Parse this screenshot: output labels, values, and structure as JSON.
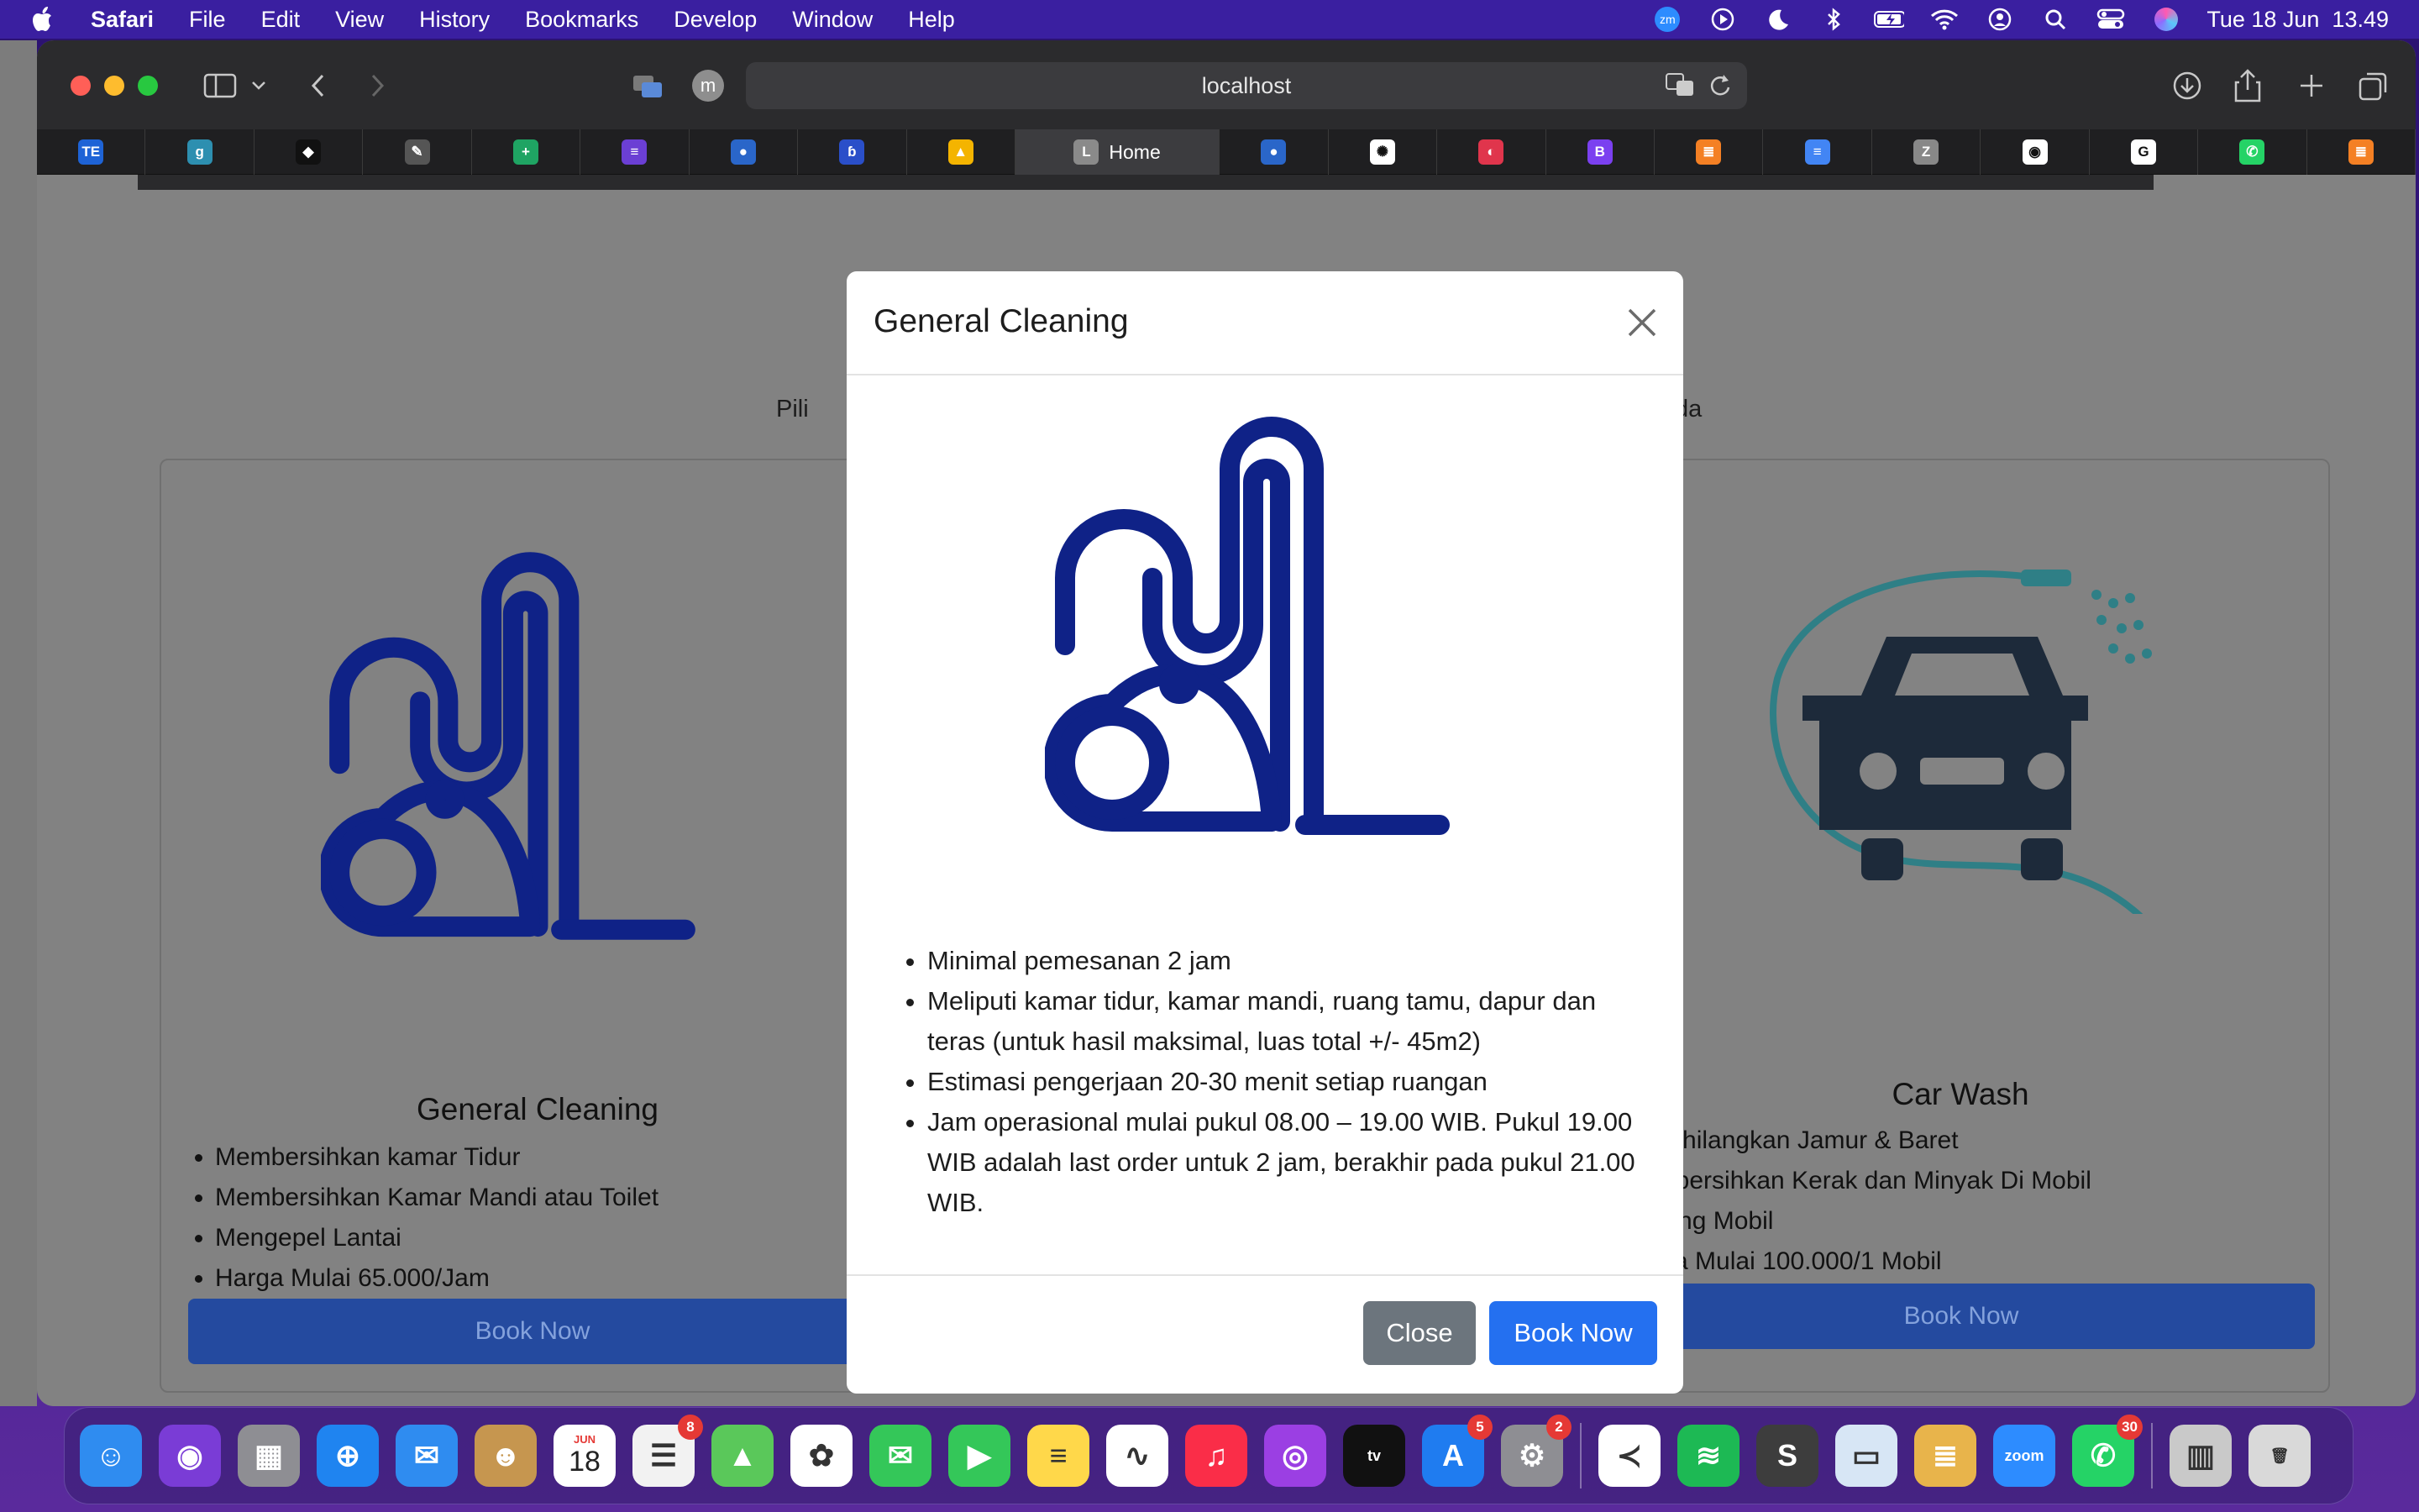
{
  "menubar": {
    "app": "Safari",
    "items": [
      "File",
      "Edit",
      "View",
      "History",
      "Bookmarks",
      "Develop",
      "Window",
      "Help"
    ],
    "status_icons": [
      "zoom-icon",
      "play-icon",
      "moon-icon",
      "bluetooth-icon",
      "battery-icon",
      "wifi-icon",
      "user-icon",
      "search-icon",
      "control-center-icon",
      "siri-icon"
    ],
    "zoom_label": "zm",
    "datetime": "Tue 18 Jun  13.49"
  },
  "browser": {
    "url": "localhost",
    "profile_initial": "m",
    "active_tab": {
      "label": "Home",
      "initial": "L"
    },
    "tabs": [
      {
        "icon": "tailwind-elements-icon",
        "color": "#1e63d6",
        "glyph": "TE"
      },
      {
        "icon": "grammar-icon",
        "color": "#2d8fb0",
        "glyph": "g"
      },
      {
        "icon": "codepen-icon",
        "color": "#111111",
        "glyph": "◆"
      },
      {
        "icon": "pencil-icon",
        "color": "#555555",
        "glyph": "✎"
      },
      {
        "icon": "sheets-icon",
        "color": "#1fa463",
        "glyph": "+"
      },
      {
        "icon": "forms-icon",
        "color": "#6b3fd4",
        "glyph": "≡"
      },
      {
        "icon": "tutwuri-icon",
        "color": "#2a66c9",
        "glyph": "●"
      },
      {
        "icon": "drop-icon",
        "color": "#2a4fc9",
        "glyph": "ɓ"
      },
      {
        "icon": "drive-icon",
        "color": "#f4b400",
        "glyph": "▲"
      },
      {
        "icon": "tutwuri-icon",
        "color": "#2a66c9",
        "glyph": "●"
      },
      {
        "icon": "chatgpt-icon",
        "color": "#ffffff",
        "glyph": "✺"
      },
      {
        "icon": "redux-icon",
        "color": "#e0354c",
        "glyph": "◐"
      },
      {
        "icon": "bootstrap-icon",
        "color": "#7b40f0",
        "glyph": "B"
      },
      {
        "icon": "stackoverflow-icon",
        "color": "#f48024",
        "glyph": "≣"
      },
      {
        "icon": "docs-icon",
        "color": "#4285f4",
        "glyph": "≡"
      },
      {
        "icon": "zotero-icon",
        "color": "#888888",
        "glyph": "Z"
      },
      {
        "icon": "github-icon",
        "color": "#ffffff",
        "glyph": "◉"
      },
      {
        "icon": "google-icon",
        "color": "#ffffff",
        "glyph": "G"
      },
      {
        "icon": "whatsapp-icon",
        "color": "#25d366",
        "glyph": "✆"
      },
      {
        "icon": "stackoverflow-icon",
        "color": "#f48024",
        "glyph": "≣"
      }
    ]
  },
  "page": {
    "intro_left": "Pili",
    "intro_right": "da",
    "cards": [
      {
        "title": "General Cleaning",
        "items": [
          "Membersihkan kamar Tidur",
          "Membersihkan Kamar Mandi atau Toilet",
          "Mengepel Lantai",
          "Harga Mulai 65.000/Jam"
        ],
        "button": "Book Now"
      },
      {
        "title": "Car Wash",
        "items": [
          "Menghilangkan Jamur & Baret",
          "Membersihkan Kerak dan Minyak Di Mobil",
          "Coating Mobil",
          "Harga Mulai 100.000/1 Mobil"
        ],
        "button": "Book Now"
      }
    ]
  },
  "modal": {
    "title": "General Cleaning",
    "items": [
      "Minimal pemesanan 2 jam",
      "Meliputi kamar tidur, kamar mandi, ruang tamu, dapur dan teras (untuk hasil maksimal, luas total +/- 45m2)",
      "Estimasi pengerjaan 20-30 menit setiap ruangan",
      "Jam operasional mulai pukul 08.00 – 19.00 WIB. Pukul 19.00 WIB adalah last order untuk 2 jam, berakhir pada pukul 21.00 WIB."
    ],
    "close_label": "Close",
    "book_label": "Book Now",
    "colors": {
      "primary": "#2470f0",
      "secondary": "#6c757d",
      "icon": "#0f2287",
      "carwash": "#1d2a3a",
      "spray": "#2f7f86"
    }
  },
  "dock": {
    "apps": [
      {
        "name": "finder-icon",
        "color": "#2f8cf0",
        "glyph": "☺"
      },
      {
        "name": "siri-icon",
        "color": "#7a3cd6",
        "glyph": "◉"
      },
      {
        "name": "launchpad-icon",
        "color": "#8e8e93",
        "glyph": "▦"
      },
      {
        "name": "safari-icon",
        "color": "#1f84f0",
        "glyph": "⊕"
      },
      {
        "name": "mail-icon",
        "color": "#2f8cf0",
        "glyph": "✉"
      },
      {
        "name": "contacts-icon",
        "color": "#c6964f",
        "glyph": "☻"
      },
      {
        "name": "calendar-icon",
        "color": "#ffffff",
        "glyph": "",
        "month": "JUN",
        "day": "18"
      },
      {
        "name": "reminders-icon",
        "color": "#f2f2f2",
        "glyph": "☰",
        "badge": "8"
      },
      {
        "name": "maps-icon",
        "color": "#5ac85a",
        "glyph": "▲"
      },
      {
        "name": "photos-icon",
        "color": "#ffffff",
        "glyph": "✿"
      },
      {
        "name": "messages-icon",
        "color": "#34c759",
        "glyph": "✉"
      },
      {
        "name": "facetime-icon",
        "color": "#34c759",
        "glyph": "▶"
      },
      {
        "name": "notes-icon",
        "color": "#ffd84a",
        "glyph": "≡"
      },
      {
        "name": "freeform-icon",
        "color": "#ffffff",
        "glyph": "∿"
      },
      {
        "name": "music-icon",
        "color": "#fa2d48",
        "glyph": "♫"
      },
      {
        "name": "podcasts-icon",
        "color": "#9b3fe3",
        "glyph": "◎"
      },
      {
        "name": "appletv-icon",
        "color": "#111111",
        "glyph": "tv"
      },
      {
        "name": "appstore-icon",
        "color": "#1f7cf0",
        "glyph": "A",
        "badge": "5"
      },
      {
        "name": "settings-icon",
        "color": "#8e8e93",
        "glyph": "⚙",
        "badge": "2"
      },
      {
        "name": "vscode-icon",
        "color": "#ffffff",
        "glyph": "≺"
      },
      {
        "name": "spotify-icon",
        "color": "#1db954",
        "glyph": "≋"
      },
      {
        "name": "sublime-icon",
        "color": "#3d3d3d",
        "glyph": "S"
      },
      {
        "name": "preview-icon",
        "color": "#d7e6f5",
        "glyph": "▭"
      },
      {
        "name": "sequel-icon",
        "color": "#e8b44b",
        "glyph": "≣"
      },
      {
        "name": "zoom-icon",
        "color": "#2d8cff",
        "glyph": "zoom"
      },
      {
        "name": "whatsapp-icon",
        "color": "#25d366",
        "glyph": "✆",
        "badge": "30"
      },
      {
        "name": "archive-icon",
        "color": "#c9c9c9",
        "glyph": "▥"
      },
      {
        "name": "trash-icon",
        "color": "#d9d9d9",
        "glyph": "🗑"
      }
    ]
  }
}
